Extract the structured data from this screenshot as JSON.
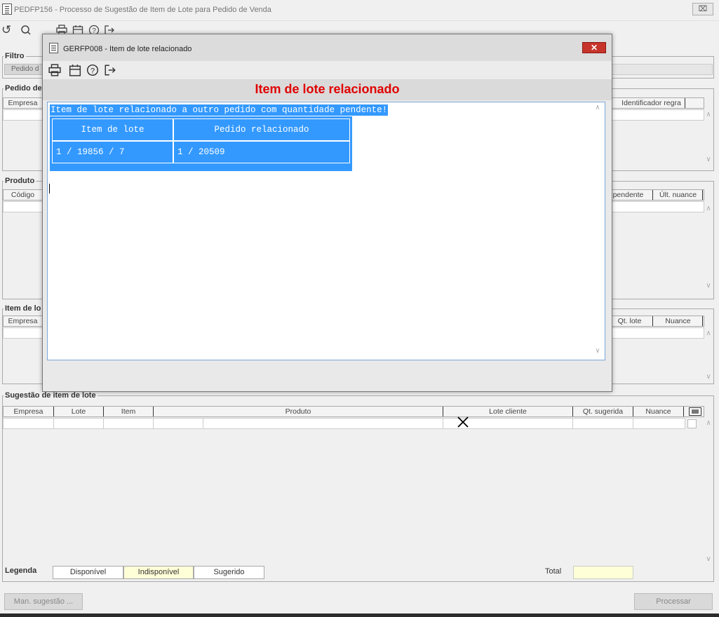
{
  "main_window": {
    "title": "PEDFP156 - Processo de Sugestão de Item de Lote para Pedido de Venda",
    "close_label": "⌧"
  },
  "toolbar": {
    "undo_icon": "undo-icon",
    "search_icon": "search-icon",
    "print_icon": "print-icon",
    "calendar_icon": "calendar-icon",
    "help_icon": "help-icon",
    "exit_icon": "exit-icon"
  },
  "filtro": {
    "legend": "Filtro",
    "pedido_label": "Pedido d"
  },
  "pedido_group": {
    "legend": "Pedido de",
    "columns": [
      "Empresa",
      "Identificador regra"
    ]
  },
  "produto_group": {
    "legend": "Produto",
    "columns": [
      "Código",
      "pendente",
      "Últ. nuance"
    ]
  },
  "item_lote_group": {
    "legend": "Item de lo",
    "columns": [
      "Empresa",
      "Qt. lote",
      "Nuance"
    ]
  },
  "sugestao_group": {
    "legend": "Sugestão de item de lote",
    "columns": [
      "Empresa",
      "Lote",
      "Item",
      "Produto",
      "Lote cliente",
      "Qt. sugerida",
      "Nuance"
    ]
  },
  "legenda": {
    "label": "Legenda",
    "disponivel": "Disponível",
    "indisponivel": "Indisponível",
    "sugerido": "Sugerido",
    "total_label": "Total",
    "total_value": ""
  },
  "buttons": {
    "man_sugestao": "Man. sugestão ...",
    "processar": "Processar"
  },
  "modal": {
    "title": "GERFP008 - Item de lote relacionado",
    "close_label": "✕",
    "heading": "Item de lote relacionado",
    "message": "Item de lote relacionado a outro pedido com quantidade pendente!",
    "table": {
      "headers": [
        "Item de lote",
        "Pedido relacionado"
      ],
      "rows": [
        [
          "1 / 19856 / 7",
          "1 / 20509"
        ]
      ]
    }
  },
  "colors": {
    "accent_red": "#e00000",
    "selection_blue": "#3399ff",
    "close_red": "#c7342b",
    "indisponivel_bg": "#ffffd7",
    "total_bg": "#ffffd7"
  }
}
